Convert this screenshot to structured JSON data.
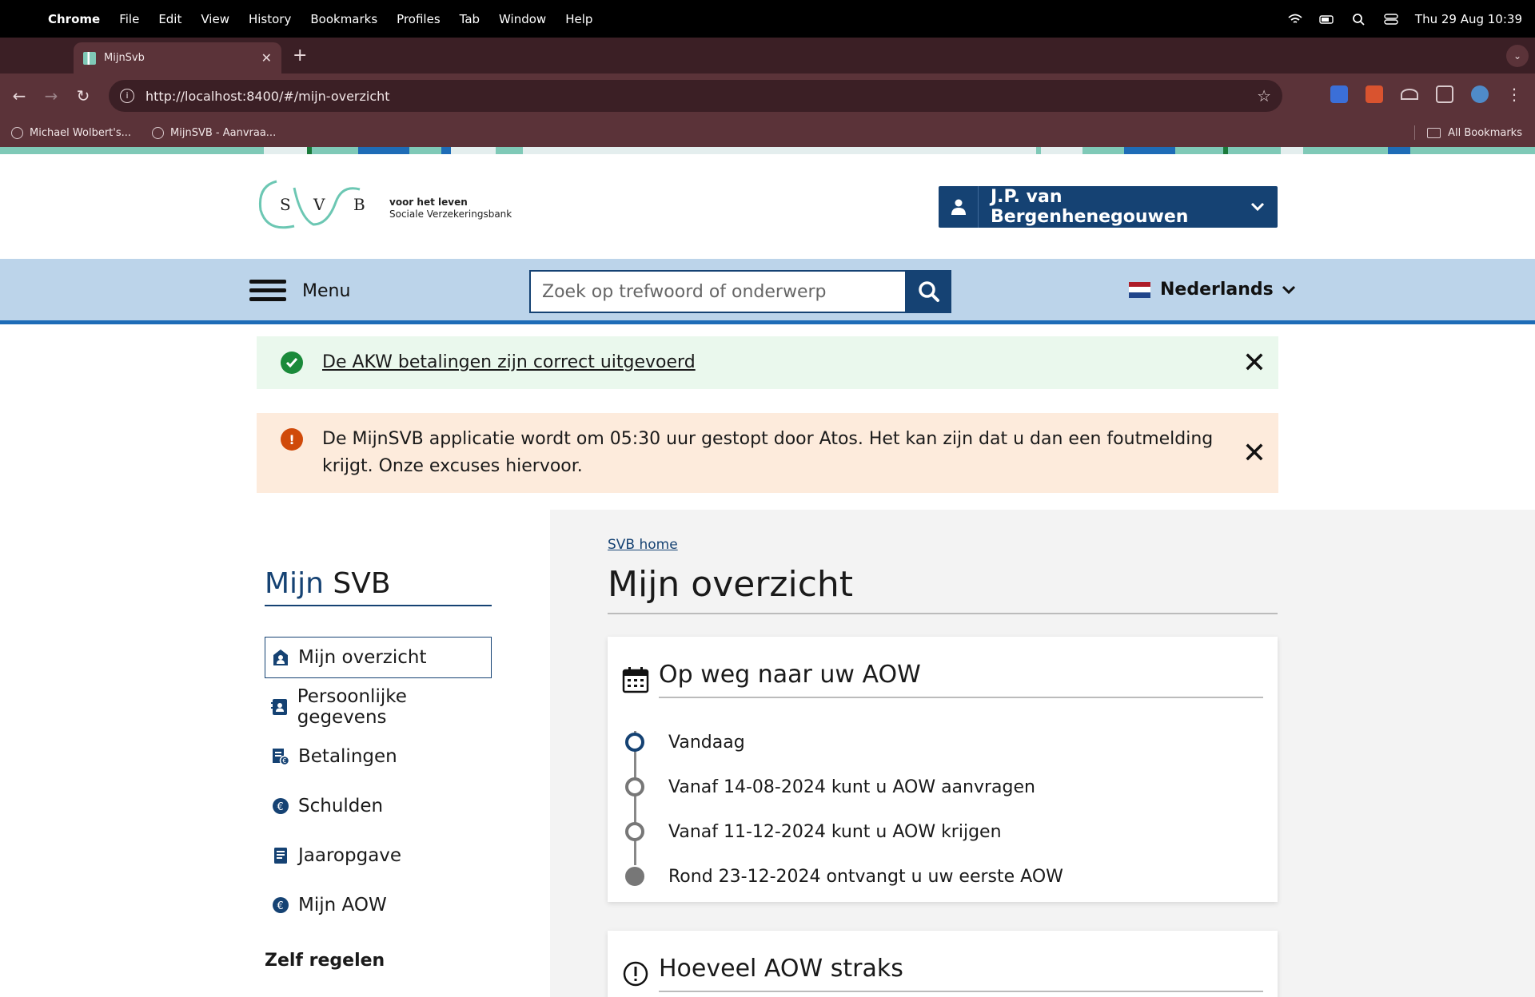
{
  "macos": {
    "app_name": "Chrome",
    "menu": [
      "File",
      "Edit",
      "View",
      "History",
      "Bookmarks",
      "Profiles",
      "Tab",
      "Window",
      "Help"
    ],
    "clock": "Thu 29 Aug  10:39"
  },
  "browser": {
    "tab_title": "MijnSvb",
    "url": "http://localhost:8400/#/mijn-overzicht",
    "bookmarks": [
      "Michael Wolbert's...",
      "MijnSVB - Aanvraa..."
    ],
    "all_bookmarks": "All Bookmarks"
  },
  "header": {
    "logo_letters": "S V B",
    "tagline": "voor het leven",
    "org_name": "Sociale Verzekeringsbank",
    "user_name": "J.P. van Bergenhenegouwen"
  },
  "navbar": {
    "menu_label": "Menu",
    "search_placeholder": "Zoek op trefwoord of onderwerp",
    "language": "Nederlands"
  },
  "alerts": {
    "success": "De AKW betalingen zijn correct uitgevoerd",
    "warning": "De MijnSVB applicatie wordt om 05:30 uur gestopt door Atos. Het kan zijn dat u dan een foutmelding krijgt. Onze excuses hiervoor."
  },
  "sidebar": {
    "title_part1": "Mijn",
    "title_part2": "SVB",
    "items": [
      {
        "label": "Mijn overzicht",
        "icon": "person-home-icon",
        "active": true
      },
      {
        "label": "Persoonlijke gegevens",
        "icon": "contact-card-icon",
        "active": false
      },
      {
        "label": "Betalingen",
        "icon": "invoice-euro-icon",
        "active": false
      },
      {
        "label": "Schulden",
        "icon": "euro-minus-icon",
        "active": false
      },
      {
        "label": "Jaaropgave",
        "icon": "document-icon",
        "active": false
      },
      {
        "label": "Mijn AOW",
        "icon": "euro-circle-icon",
        "active": false
      }
    ],
    "section_heading": "Zelf regelen"
  },
  "main": {
    "breadcrumb": "SVB home",
    "title": "Mijn overzicht",
    "aow_card": {
      "title": "Op weg naar uw AOW",
      "timeline": [
        "Vandaag",
        "Vanaf 14-08-2024 kunt u AOW aanvragen",
        "Vanaf 11-12-2024 kunt u AOW krijgen",
        "Rond 23-12-2024 ontvangt u uw eerste AOW"
      ]
    },
    "amount_card": {
      "title": "Hoeveel AOW straks"
    }
  },
  "colors": {
    "brand_dark_blue": "#154273",
    "band_light_blue": "#bcd4ea",
    "success_green": "#1a8a3a",
    "warning_orange": "#d04a0a"
  }
}
